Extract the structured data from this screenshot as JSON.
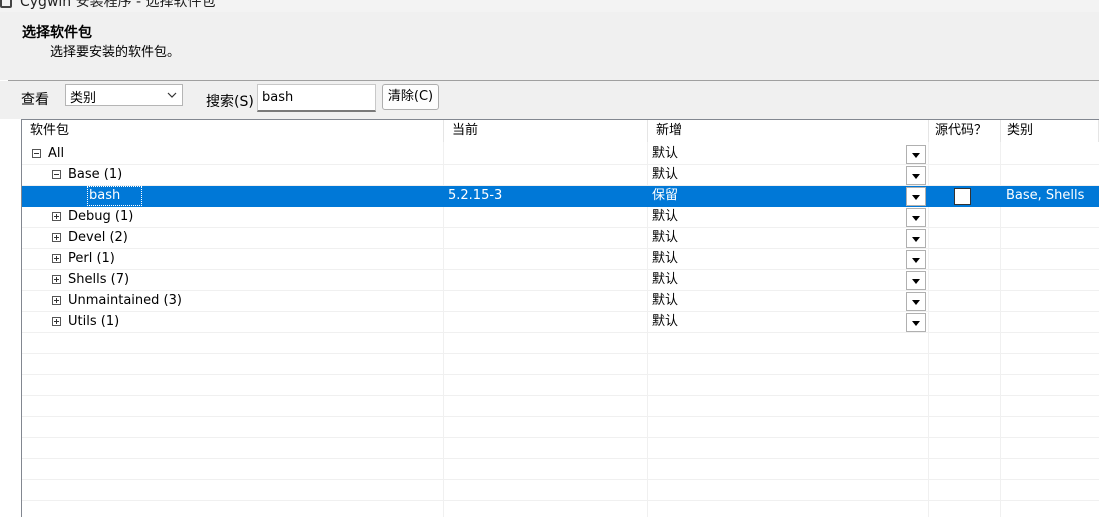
{
  "window": {
    "title": "Cygwin 安装程序 - 选择软件包"
  },
  "header": {
    "title": "选择软件包",
    "subtitle": "选择要安装的软件包。"
  },
  "toolbar": {
    "view_label": "查看",
    "view_value": "类别",
    "search_label": "搜索(S)",
    "search_value": "bash",
    "clear_label": "清除(C)"
  },
  "table": {
    "columns": [
      "软件包",
      "当前",
      "新增",
      "源代码？",
      "类别"
    ],
    "rows": [
      {
        "name": "All",
        "current": "",
        "new": "默认",
        "category": "",
        "expander": "minus",
        "level": 0
      },
      {
        "name": "Base (1)",
        "current": "",
        "new": "默认",
        "category": "",
        "expander": "minus",
        "level": 1
      },
      {
        "name": "bash",
        "current": "5.2.15-3",
        "new": "保留",
        "category": "Base, Shells",
        "expander": "none",
        "level": 2,
        "selected": true,
        "has_source_checkbox": true
      },
      {
        "name": "Debug (1)",
        "current": "",
        "new": "默认",
        "category": "",
        "expander": "plus",
        "level": 1
      },
      {
        "name": "Devel (2)",
        "current": "",
        "new": "默认",
        "category": "",
        "expander": "plus",
        "level": 1
      },
      {
        "name": "Perl (1)",
        "current": "",
        "new": "默认",
        "category": "",
        "expander": "plus",
        "level": 1
      },
      {
        "name": "Shells (7)",
        "current": "",
        "new": "默认",
        "category": "",
        "expander": "plus",
        "level": 1
      },
      {
        "name": "Unmaintained (3)",
        "current": "",
        "new": "默认",
        "category": "",
        "expander": "plus",
        "level": 1
      },
      {
        "name": "Utils (1)",
        "current": "",
        "new": "默认",
        "category": "",
        "expander": "plus",
        "level": 1
      }
    ]
  },
  "colors": {
    "selection": "#0078d7",
    "header_bg": "#f0f0f0"
  }
}
